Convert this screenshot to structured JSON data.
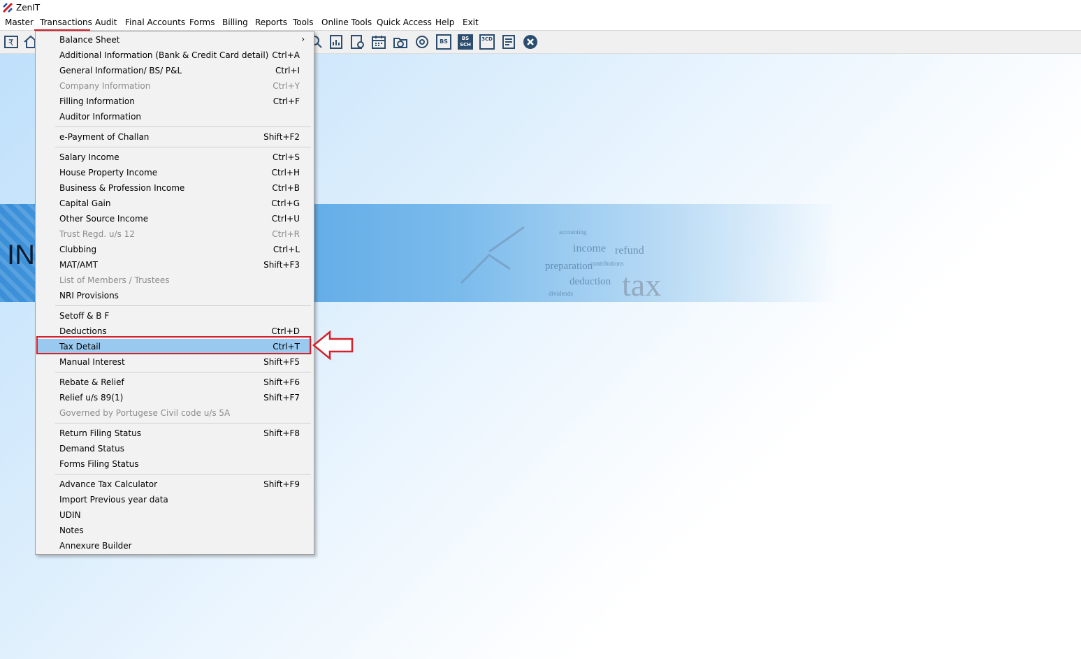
{
  "app": {
    "title": "ZenIT",
    "logo_icon": "zenit-logo-icon"
  },
  "menubar": {
    "items": [
      {
        "label": "Master"
      },
      {
        "label": "Transactions"
      },
      {
        "label": "Audit"
      },
      {
        "label": "Final Accounts"
      },
      {
        "label": "Forms"
      },
      {
        "label": "Billing"
      },
      {
        "label": "Reports"
      },
      {
        "label": "Tools"
      },
      {
        "label": "Online Tools"
      },
      {
        "label": "Quick Access"
      },
      {
        "label": "Help"
      },
      {
        "label": "Exit"
      }
    ],
    "active": "Transactions"
  },
  "toolbar": {
    "icons": [
      "rupee-book-icon",
      "home-icon",
      "search-icon",
      "report-icon",
      "user-doc-icon",
      "calendar-icon",
      "folder-add-icon",
      "disc-icon",
      "bs-icon",
      "bs-sch-icon",
      "3cd-icon",
      "list-doc-icon",
      "close-circle-icon"
    ],
    "labels": {
      "bs": "BS",
      "bs_sch_top": "BS",
      "bs_sch_bottom": "SCH",
      "3cd": "3CD"
    }
  },
  "banner": {
    "text": "INC"
  },
  "dropdown": {
    "items": [
      {
        "label": "Balance Sheet",
        "shortcut": "",
        "submenu": true,
        "enabled": true
      },
      {
        "label": "Additional Information (Bank & Credit Card detail)",
        "shortcut": "Ctrl+A",
        "enabled": true
      },
      {
        "label": "General Information/ BS/ P&L",
        "shortcut": "Ctrl+I",
        "enabled": true
      },
      {
        "label": "Company Information",
        "shortcut": "Ctrl+Y",
        "enabled": false
      },
      {
        "label": "Filling Information",
        "shortcut": "Ctrl+F",
        "enabled": true
      },
      {
        "label": "Auditor Information",
        "shortcut": "",
        "enabled": true
      },
      {
        "label": "e-Payment of Challan",
        "shortcut": "Shift+F2",
        "enabled": true
      },
      {
        "label": "Salary Income",
        "shortcut": "Ctrl+S",
        "enabled": true
      },
      {
        "label": "House Property Income",
        "shortcut": "Ctrl+H",
        "enabled": true
      },
      {
        "label": "Business & Profession Income",
        "shortcut": "Ctrl+B",
        "enabled": true
      },
      {
        "label": "Capital Gain",
        "shortcut": "Ctrl+G",
        "enabled": true
      },
      {
        "label": "Other Source Income",
        "shortcut": "Ctrl+U",
        "enabled": true
      },
      {
        "label": "Trust Regd. u/s 12",
        "shortcut": "Ctrl+R",
        "enabled": false
      },
      {
        "label": "Clubbing",
        "shortcut": "Ctrl+L",
        "enabled": true
      },
      {
        "label": "MAT/AMT",
        "shortcut": "Shift+F3",
        "enabled": true
      },
      {
        "label": "List of Members / Trustees",
        "shortcut": "",
        "enabled": false
      },
      {
        "label": "NRI Provisions",
        "shortcut": "",
        "enabled": true
      },
      {
        "label": "Setoff & B F",
        "shortcut": "",
        "enabled": true
      },
      {
        "label": "Deductions",
        "shortcut": "Ctrl+D",
        "enabled": true
      },
      {
        "label": "Tax Detail",
        "shortcut": "Ctrl+T",
        "enabled": true,
        "selected": true
      },
      {
        "label": "Manual Interest",
        "shortcut": "Shift+F5",
        "enabled": true
      },
      {
        "label": "Rebate & Relief",
        "shortcut": "Shift+F6",
        "enabled": true
      },
      {
        "label": "Relief u/s 89(1)",
        "shortcut": "Shift+F7",
        "enabled": true
      },
      {
        "label": "Governed by Portugese Civil code u/s 5A",
        "shortcut": "",
        "enabled": false
      },
      {
        "label": "Return Filing Status",
        "shortcut": "Shift+F8",
        "enabled": true
      },
      {
        "label": "Demand Status",
        "shortcut": "",
        "enabled": true
      },
      {
        "label": "Forms Filing Status",
        "shortcut": "",
        "enabled": true
      },
      {
        "label": "Advance Tax Calculator",
        "shortcut": "Shift+F9",
        "enabled": true
      },
      {
        "label": "Import Previous year data",
        "shortcut": "",
        "enabled": true
      },
      {
        "label": "UDIN",
        "shortcut": "",
        "enabled": true
      },
      {
        "label": "Notes",
        "shortcut": "",
        "enabled": true
      },
      {
        "label": "Annexure Builder",
        "shortcut": "",
        "enabled": true
      }
    ]
  },
  "colors": {
    "highlight": "#d6202b",
    "selected": "#99c9ef",
    "menu_bg": "#f2f2f2"
  }
}
